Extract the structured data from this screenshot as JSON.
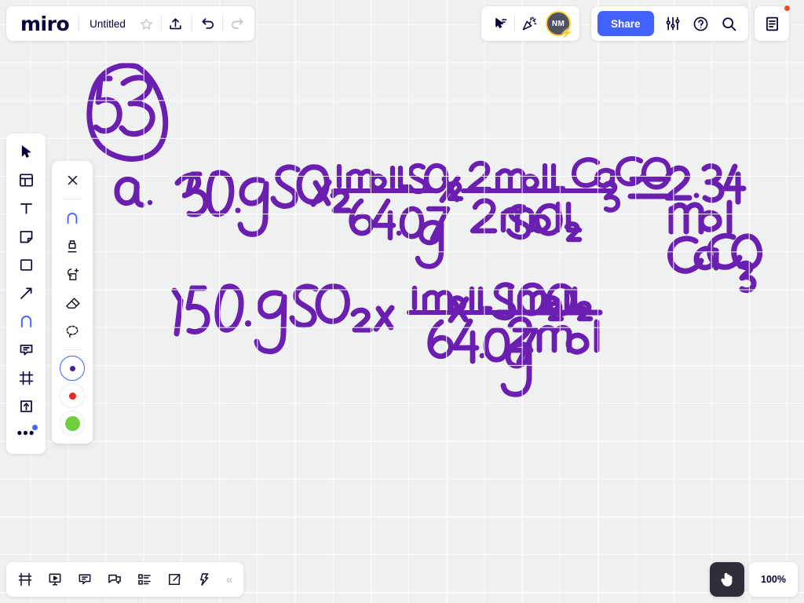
{
  "app": {
    "logo": "miro",
    "zoom_level": "100%"
  },
  "topbar": {
    "doc_title": "Untitled",
    "star_icon": "star-icon",
    "upload_icon": "upload-icon",
    "undo_icon": "undo-icon",
    "redo_icon": "redo-icon",
    "cursor_share_icon": "cursor-label-icon",
    "celebrate_icon": "party-popper-icon",
    "avatar_initials": "NM",
    "share_label": "Share",
    "settings_icon": "sliders-icon",
    "help_icon": "help-circle-icon",
    "search_icon": "search-icon",
    "notes_icon": "notes-document-icon",
    "accent_color": "#4262ff",
    "notification_color": "#f24726",
    "avatar_ring_color": "#ffd02f"
  },
  "left_toolbar": {
    "items": [
      {
        "name": "select-cursor-tool",
        "icon": "cursor-arrow-icon"
      },
      {
        "name": "templates-tool",
        "icon": "template-layout-icon"
      },
      {
        "name": "text-tool",
        "icon": "text-T-icon"
      },
      {
        "name": "sticky-note-tool",
        "icon": "sticky-note-icon"
      },
      {
        "name": "shapes-tool",
        "icon": "square-shape-icon"
      },
      {
        "name": "connection-line-tool",
        "icon": "arrow-diagonal-icon"
      },
      {
        "name": "pen-tool",
        "icon": "pen-arc-icon",
        "active": true
      },
      {
        "name": "comment-tool",
        "icon": "comment-bubble-icon"
      },
      {
        "name": "frame-tool",
        "icon": "frame-icon"
      },
      {
        "name": "upload-tool",
        "icon": "upload-box-icon"
      },
      {
        "name": "more-tools",
        "icon": "ellipsis-icon",
        "badge": true
      }
    ]
  },
  "pen_panel": {
    "close_icon": "close-x-icon",
    "tools": [
      {
        "name": "pen",
        "icon": "pen-arc-icon",
        "selected": true
      },
      {
        "name": "marker",
        "icon": "marker-icon"
      },
      {
        "name": "smart-drawing",
        "icon": "smart-shape-icon"
      },
      {
        "name": "eraser",
        "icon": "eraser-icon"
      },
      {
        "name": "lasso-select",
        "icon": "lasso-dashed-icon"
      }
    ],
    "colors": [
      {
        "name": "purple-swatch",
        "hex": "#4b1e9e",
        "size": 7,
        "active": true
      },
      {
        "name": "red-swatch",
        "hex": "#e02b20",
        "size": 9,
        "active": false
      },
      {
        "name": "green-swatch",
        "hex": "#6fcf3f",
        "size": 19,
        "active": false
      }
    ]
  },
  "bottom_toolbar": {
    "items": [
      {
        "name": "table-frames-icon",
        "icon": "table-icon"
      },
      {
        "name": "presentation-mode-icon",
        "icon": "presentation-icon"
      },
      {
        "name": "comments-panel-icon",
        "icon": "comment-lines-icon"
      },
      {
        "name": "chat-panel-icon",
        "icon": "chat-bubbles-icon"
      },
      {
        "name": "apps-list-icon",
        "icon": "list-blocks-icon"
      },
      {
        "name": "export-share-icon",
        "icon": "external-link-icon"
      },
      {
        "name": "automation-icon",
        "icon": "lightning-bolt-icon"
      }
    ],
    "collapse_icon": "double-chevron-left-icon"
  },
  "canvas": {
    "background_color": "#eff0f0",
    "grid_color": "#f9fafa",
    "ink_color": "#6a1fb0",
    "handwriting": {
      "problem_number": "53",
      "line_a_label": "a.",
      "line_1": "150. g SO₂  ×  1 mol SO₂ / 64.07 g  ×  2 mol CaCO₃ / 2 mol SO₂  =  2.34 mol CaCO₃",
      "line_1_parts": {
        "given": "150. g SO₂",
        "factor_1_num": "1 mol SO₂",
        "factor_1_den": "64.07 g",
        "factor_2_num": "2 mol CaCO₃",
        "factor_2_den": "2 mol SO₂",
        "result_value": "2.34",
        "result_unit_1": "mol",
        "result_unit_2": "CaCO₃"
      },
      "line_2": "150. g SO₂  ×  1 mol SO₂ / 64.07 g  ×  1 mol O₂ / 2 mol",
      "line_2_parts": {
        "given": "150. g SO₂",
        "factor_1_num": "1 mol SO₂",
        "factor_1_den": "64.07 g",
        "factor_2_num": "1 mol O₂",
        "factor_2_den": "2 mol"
      }
    }
  }
}
